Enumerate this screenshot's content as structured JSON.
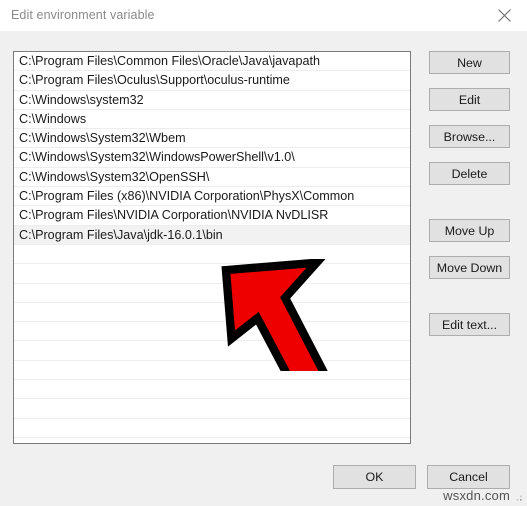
{
  "window": {
    "title": "Edit environment variable",
    "close_icon": "close-icon"
  },
  "list": {
    "items": [
      "C:\\Program Files\\Common Files\\Oracle\\Java\\javapath",
      "C:\\Program Files\\Oculus\\Support\\oculus-runtime",
      "C:\\Windows\\system32",
      "C:\\Windows",
      "C:\\Windows\\System32\\Wbem",
      "C:\\Windows\\System32\\WindowsPowerShell\\v1.0\\",
      "C:\\Windows\\System32\\OpenSSH\\",
      "C:\\Program Files (x86)\\NVIDIA Corporation\\PhysX\\Common",
      "C:\\Program Files\\NVIDIA Corporation\\NVIDIA NvDLISR",
      "C:\\Program Files\\Java\\jdk-16.0.1\\bin"
    ],
    "selected_index": 9,
    "empty_rows": 10
  },
  "side_buttons": {
    "new": "New",
    "edit": "Edit",
    "browse": "Browse...",
    "delete": "Delete",
    "move_up": "Move Up",
    "move_down": "Move Down",
    "edit_text": "Edit text..."
  },
  "bottom_buttons": {
    "ok": "OK",
    "cancel": "Cancel"
  },
  "annotation": {
    "arrow_color": "#ee0000",
    "arrow_outline": "#000000",
    "name": "red-arrow-pointer"
  },
  "watermark": {
    "text": "wsxdn.com"
  },
  "colors": {
    "dialog_background": "#f0f0f0",
    "titlebar_background": "#ffffff",
    "list_background": "#ffffff",
    "list_border": "#7a7a7a",
    "selected_row": "#f2f2f2",
    "button_face": "#e1e1e1",
    "button_border": "#adadad",
    "title_text": "#8a8a8a"
  }
}
